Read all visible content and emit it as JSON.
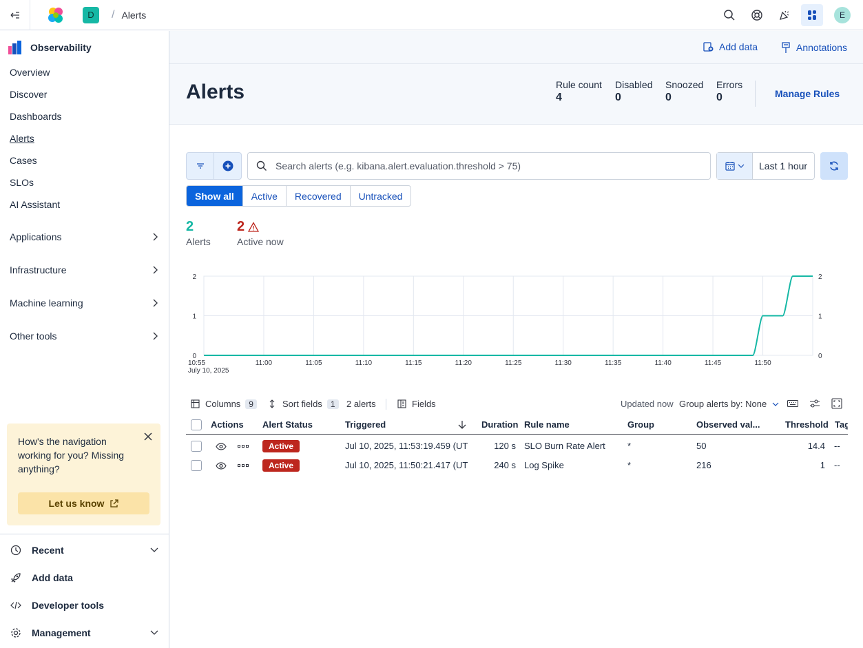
{
  "topbar": {
    "space_initial": "D",
    "breadcrumb": "Alerts",
    "user_initial": "E"
  },
  "sidebar": {
    "title": "Observability",
    "items": [
      "Overview",
      "Discover",
      "Dashboards",
      "Alerts",
      "Cases",
      "SLOs",
      "AI Assistant"
    ],
    "expandable": [
      "Applications",
      "Infrastructure",
      "Machine learning",
      "Other tools"
    ],
    "feedback": {
      "text": "How's the navigation working for you? Missing anything?",
      "button": "Let us know"
    },
    "footer": [
      "Recent",
      "Add data",
      "Developer tools",
      "Management"
    ]
  },
  "header": {
    "add_data": "Add data",
    "annotations": "Annotations",
    "title": "Alerts",
    "stats": [
      {
        "label": "Rule count",
        "value": "4"
      },
      {
        "label": "Disabled",
        "value": "0"
      },
      {
        "label": "Snoozed",
        "value": "0"
      },
      {
        "label": "Errors",
        "value": "0"
      }
    ],
    "manage_rules": "Manage Rules"
  },
  "filters": {
    "search_placeholder": "Search alerts (e.g. kibana.alert.evaluation.threshold > 75)",
    "time_range": "Last 1 hour",
    "status_tabs": [
      "Show all",
      "Active",
      "Recovered",
      "Untracked"
    ],
    "selected_tab": "Show all"
  },
  "summary": {
    "alerts_count": "2",
    "alerts_label": "Alerts",
    "active_count": "2",
    "active_label": "Active now"
  },
  "chart_data": {
    "type": "line",
    "x": [
      "10:55",
      "11:00",
      "11:05",
      "11:10",
      "11:15",
      "11:20",
      "11:25",
      "11:30",
      "11:35",
      "11:40",
      "11:45",
      "11:49",
      "11:50",
      "11:52",
      "11:53",
      "11:55"
    ],
    "x_tick_labels": [
      "10:55",
      "11:00",
      "11:05",
      "11:10",
      "11:15",
      "11:20",
      "11:25",
      "11:30",
      "11:35",
      "11:40",
      "11:45",
      "11:50"
    ],
    "x_sublabel": "July 10, 2025",
    "series": [
      {
        "values": [
          0,
          0,
          0,
          0,
          0,
          0,
          0,
          0,
          0,
          0,
          0,
          0,
          1,
          1,
          2,
          2
        ]
      }
    ],
    "y_ticks": [
      0,
      1,
      2
    ],
    "ylim": [
      0,
      2
    ],
    "color": "#16b8a5",
    "grid": true
  },
  "table": {
    "toolbar": {
      "columns_label": "Columns",
      "columns_count": "9",
      "sort_label": "Sort fields",
      "sort_count": "1",
      "alerts_count": "2 alerts",
      "fields_label": "Fields",
      "updated": "Updated now",
      "group_by": "Group alerts by: None"
    },
    "headers": [
      "Actions",
      "Alert Status",
      "Triggered",
      "Duration",
      "Rule name",
      "Group",
      "Observed val...",
      "Threshold",
      "Tag"
    ],
    "rows": [
      {
        "status": "Active",
        "triggered": "Jul 10, 2025, 11:53:19.459 (UT",
        "duration": "120 s",
        "rule": "SLO Burn Rate Alert",
        "group": "*",
        "observed": "50",
        "threshold": "14.4",
        "tags": "--"
      },
      {
        "status": "Active",
        "triggered": "Jul 10, 2025, 11:50:21.417 (UT",
        "duration": "240 s",
        "rule": "Log Spike",
        "group": "*",
        "observed": "216",
        "threshold": "1",
        "tags": "--"
      }
    ]
  }
}
